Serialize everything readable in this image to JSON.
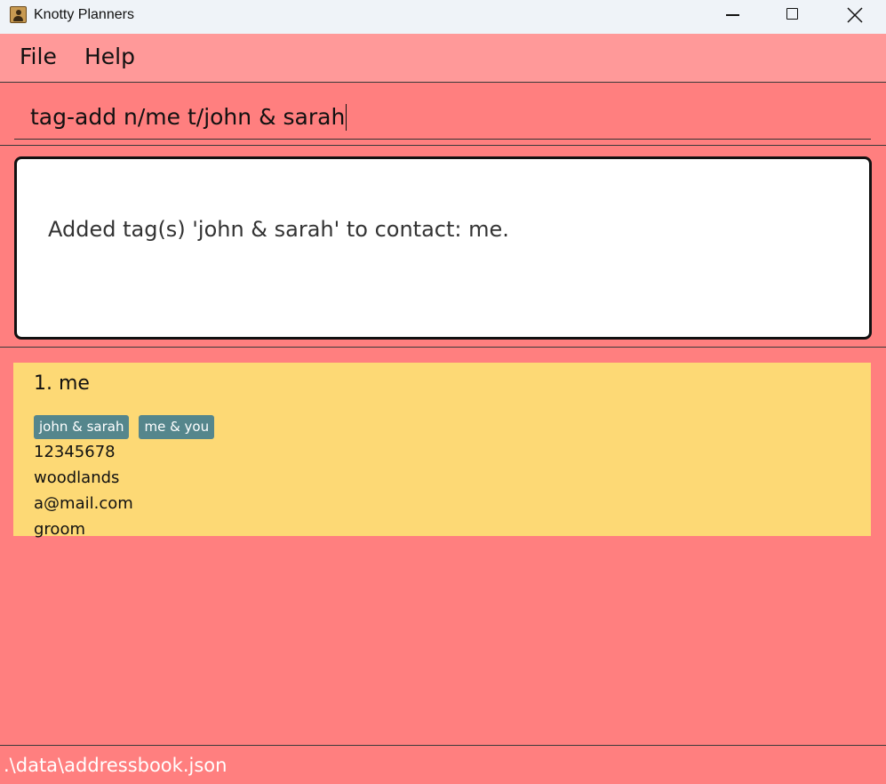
{
  "window": {
    "title": "Knotty Planners",
    "app_icon": "address-book-icon"
  },
  "menu": {
    "items": [
      "File",
      "Help"
    ]
  },
  "command": {
    "value": "tag-add n/me t/john & sarah"
  },
  "result": {
    "message": "Added tag(s) 'john & sarah' to contact: me."
  },
  "persons": [
    {
      "index_name": "1. me",
      "tags": [
        "john & sarah",
        "me & you"
      ],
      "phone": "12345678",
      "address": "woodlands",
      "email": "a@mail.com",
      "role": "groom"
    }
  ],
  "status": {
    "file_path": ".\\data\\addressbook.json"
  },
  "colors": {
    "background": "#FF7F7F",
    "menu_bar": "#FF9999",
    "card": "#FDD975",
    "tag": "#55868C"
  }
}
